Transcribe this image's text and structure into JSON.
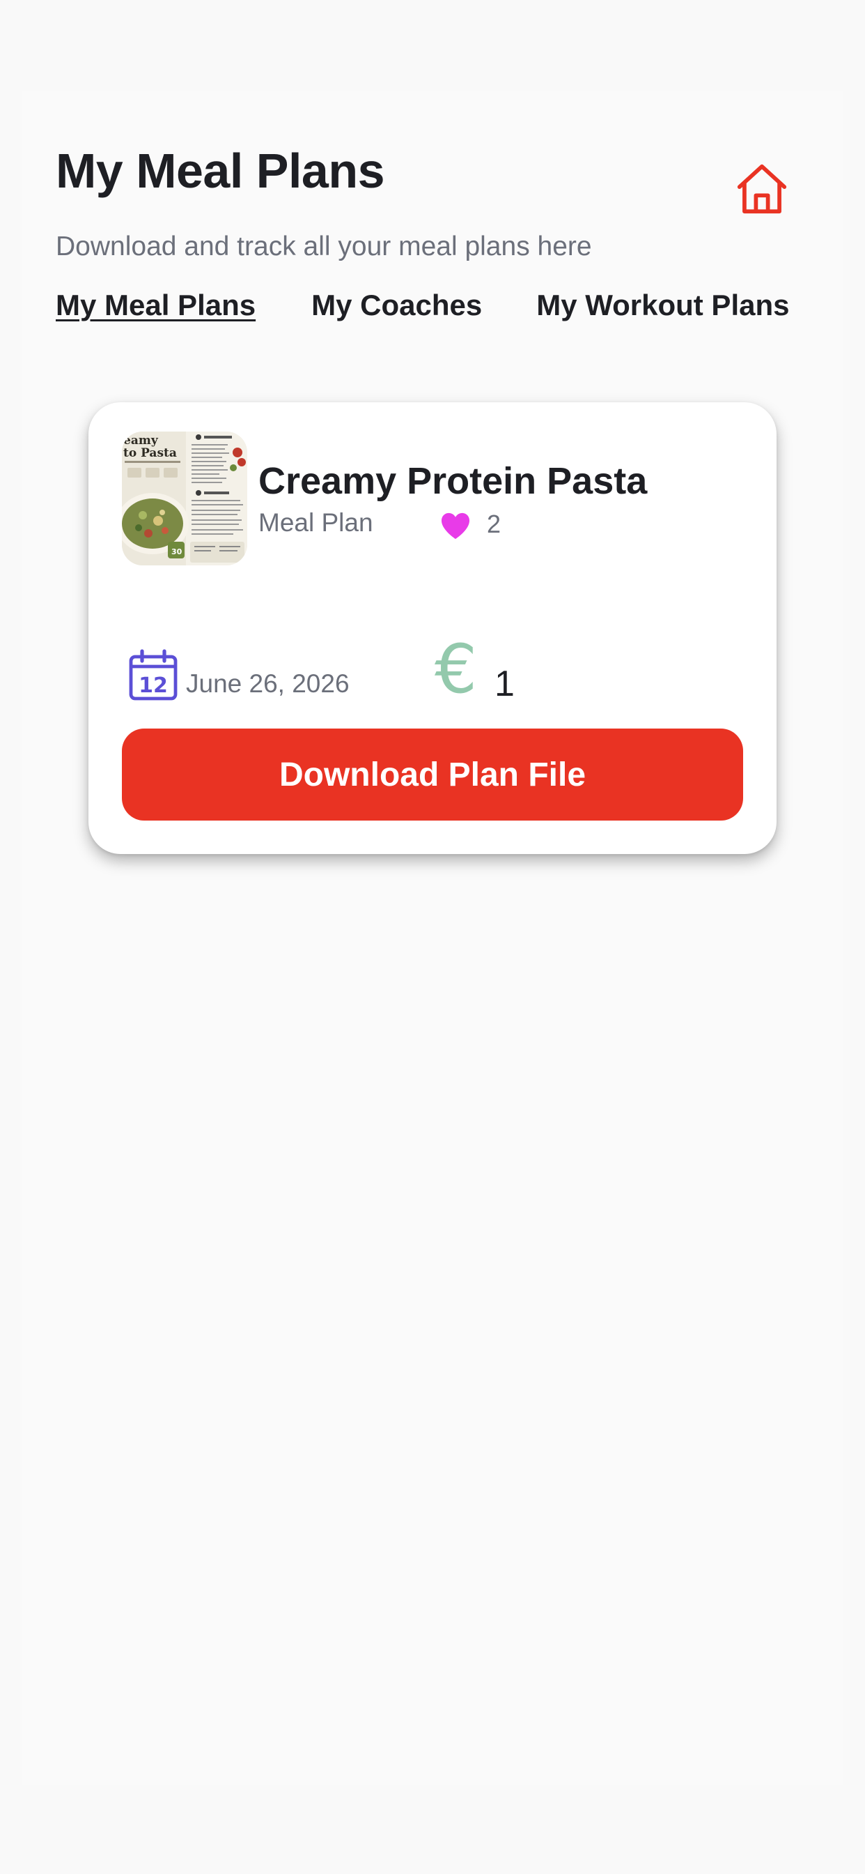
{
  "header": {
    "title": "My Meal Plans",
    "subtitle": "Download and track all your meal plans here",
    "home_icon": "home-icon"
  },
  "tabs": [
    {
      "label": "My Meal Plans",
      "active": true
    },
    {
      "label": "My Coaches",
      "active": false
    },
    {
      "label": "My Workout Plans",
      "active": false
    }
  ],
  "plan_card": {
    "title": "Creamy Protein Pasta",
    "type": "Meal Plan",
    "likes": "2",
    "calendar_day": "12",
    "date": "June 26, 2026",
    "currency_symbol": "€",
    "price": "1",
    "download_label": "Download Plan File"
  },
  "colors": {
    "accent": "#e93323",
    "heart": "#e83be8",
    "calendar": "#5b4fd6",
    "euro": "#93c9ac",
    "text_dark": "#1e1f24",
    "text_muted": "#6b6f7a"
  }
}
